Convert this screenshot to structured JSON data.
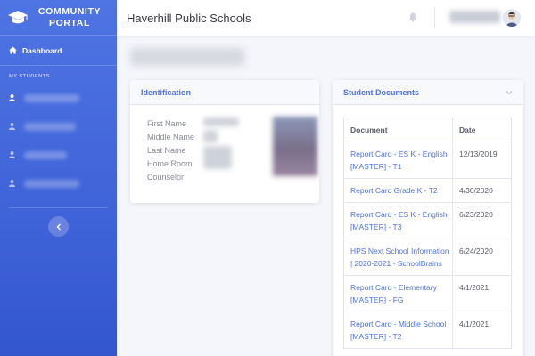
{
  "app": {
    "brand_line1": "COMMUNITY",
    "brand_line2": "PORTAL",
    "school_name": "Haverhill Public Schools"
  },
  "sidebar": {
    "dashboard_label": "Dashboard",
    "section_label": "MY STUDENTS",
    "student_count": 4
  },
  "identification": {
    "title": "Identification",
    "labels": [
      "First Name",
      "Middle Name",
      "Last Name",
      "Home Room",
      "Counselor"
    ]
  },
  "documents": {
    "title": "Student Documents",
    "columns": [
      "Document",
      "Date"
    ],
    "rows": [
      {
        "name": "Report Card - ES K - English [MASTER] - T1",
        "date": "12/13/2019"
      },
      {
        "name": "Report Card Grade K - T2",
        "date": "4/30/2020"
      },
      {
        "name": "Report Card - ES K - English [MASTER] - T3",
        "date": "6/23/2020"
      },
      {
        "name": "HPS Next School Information | 2020-2021 - SchoolBrains",
        "date": "6/24/2020"
      },
      {
        "name": "Report Card - Elementary [MASTER] - FG",
        "date": "4/1/2021"
      },
      {
        "name": "Report Card - Middle School [MASTER] - T2",
        "date": "4/1/2021"
      }
    ]
  },
  "colors": {
    "accent": "#4e73df",
    "sidebar_top": "#4f74e3",
    "sidebar_bottom": "#3356cf"
  }
}
